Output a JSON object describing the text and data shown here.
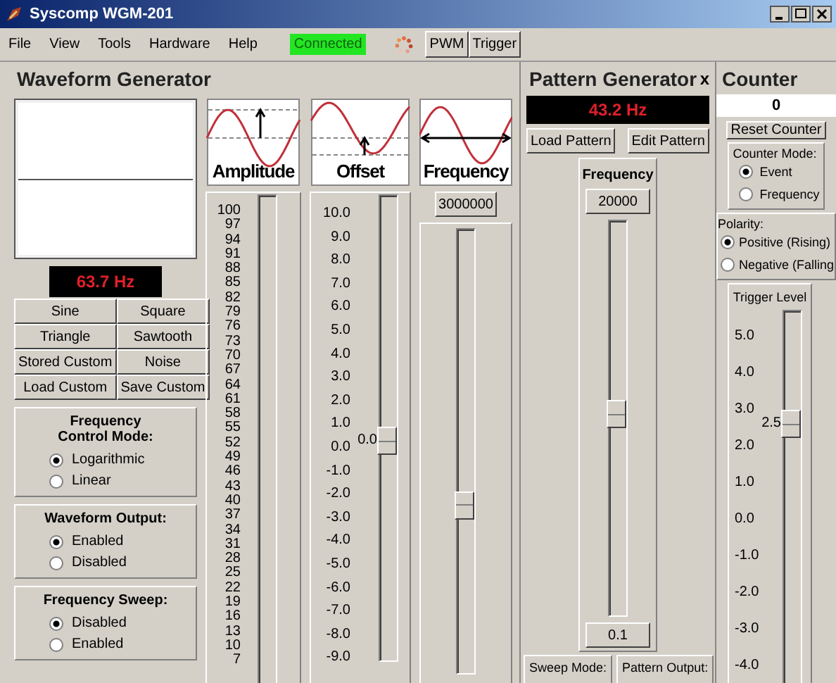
{
  "window": {
    "title": "Syscomp WGM-201"
  },
  "menu": [
    "File",
    "View",
    "Tools",
    "Hardware",
    "Help"
  ],
  "connection_status": "Connected",
  "toolbar_buttons": [
    "PWM",
    "Trigger"
  ],
  "waveform_generator": {
    "title": "Waveform Generator",
    "frequency_display": "63.7 Hz",
    "waveform_buttons": [
      "Sine",
      "Square",
      "Triangle",
      "Sawtooth",
      "Stored Custom",
      "Noise",
      "Load Custom",
      "Save Custom"
    ],
    "groups": [
      {
        "title": "Frequency\nControl Mode:",
        "options": [
          {
            "label": "Logarithmic",
            "selected": true
          },
          {
            "label": "Linear",
            "selected": false
          }
        ]
      },
      {
        "title": "Waveform Output:",
        "options": [
          {
            "label": "Enabled",
            "selected": true
          },
          {
            "label": "Disabled",
            "selected": false
          }
        ]
      },
      {
        "title": "Frequency Sweep:",
        "options": [
          {
            "label": "Disabled",
            "selected": true
          },
          {
            "label": "Enabled",
            "selected": false
          }
        ]
      }
    ],
    "amplitude": {
      "label": "Amplitude",
      "scale": [
        "100",
        "97",
        "94",
        "91",
        "88",
        "85",
        "82",
        "79",
        "76",
        "73",
        "70",
        "67",
        "64",
        "61",
        "58",
        "55",
        "52",
        "49",
        "46",
        "43",
        "40",
        "37",
        "34",
        "31",
        "28",
        "25",
        "22",
        "19",
        "16",
        "13",
        "10",
        "7"
      ]
    },
    "offset": {
      "label": "Offset",
      "scale": [
        "10.0",
        "9.0",
        "8.0",
        "7.0",
        "6.0",
        "5.0",
        "4.0",
        "3.0",
        "2.0",
        "1.0",
        "0.0",
        "-1.0",
        "-2.0",
        "-3.0",
        "-4.0",
        "-5.0",
        "-6.0",
        "-7.0",
        "-8.0",
        "-9.0"
      ],
      "reading": "0.0",
      "level": 0.47
    },
    "frequency": {
      "label": "Frequency",
      "value": "3000000",
      "level": 0.37
    }
  },
  "pattern_generator": {
    "title": "Pattern Generator",
    "close": "x",
    "frequency_display": "43.2 Hz",
    "buttons": [
      "Load Pattern",
      "Edit Pattern"
    ],
    "frequency": {
      "label": "Frequency",
      "max": "20000",
      "min": "0.1",
      "level": 0.51
    },
    "footer": [
      "Sweep Mode:",
      "Pattern Output:"
    ]
  },
  "counter": {
    "title": "Counter",
    "value": "0",
    "reset_button": "Reset Counter",
    "mode": {
      "title": "Counter Mode:",
      "options": [
        {
          "label": "Event",
          "selected": true
        },
        {
          "label": "Frequency",
          "selected": false
        }
      ]
    },
    "polarity": {
      "title": "Polarity:",
      "options": [
        {
          "label": "Positive (Rising)",
          "selected": true
        },
        {
          "label": "Negative (Falling",
          "selected": false
        }
      ]
    },
    "trigger_level": {
      "title": "Trigger Level",
      "scale": [
        "5.0",
        "4.0",
        "3.0",
        "2.0",
        "1.0",
        "0.0",
        "-1.0",
        "-2.0",
        "-3.0",
        "-4.0"
      ],
      "reading": "2.5",
      "level": 0.72
    }
  }
}
